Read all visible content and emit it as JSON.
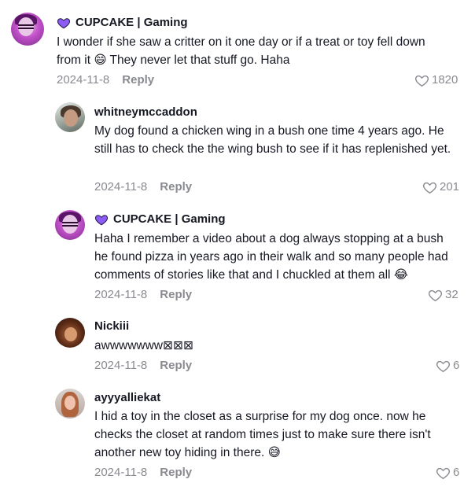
{
  "comments": [
    {
      "username": "CUPCAKE | Gaming",
      "text": "I wonder if she saw a critter on it one day or if a treat or toy fell down from it 😄 They never let that stuff go. Haha",
      "date": "2024-11-8",
      "reply_label": "Reply",
      "likes": "1820",
      "badge": "purple-heart-icon"
    },
    {
      "username": "whitneymccaddon",
      "text": "My dog found a chicken wing in a bush one time 4 years ago. He still has to check the the wing bush to see if it has replenished yet.",
      "date": "2024-11-8",
      "reply_label": "Reply",
      "likes": "201"
    },
    {
      "username": "CUPCAKE | Gaming",
      "text": "Haha I remember a video about a dog always stopping at a bush he found pizza in years ago in their walk and so many people had comments of stories like that and I chuckled at them all 😂",
      "date": "2024-11-8",
      "reply_label": "Reply",
      "likes": "32",
      "badge": "purple-heart-icon"
    },
    {
      "username": "Nickiii",
      "text": "awwwwwww⊠⊠⊠",
      "date": "2024-11-8",
      "reply_label": "Reply",
      "likes": "6"
    },
    {
      "username": "ayyyalliekat",
      "text": "I hid a toy in the closet as a surprise for my dog once. now he checks the closet at random times just to make sure there isn't another new toy hiding in there. 😅",
      "date": "2024-11-8",
      "reply_label": "Reply",
      "likes": "6"
    }
  ],
  "colors": {
    "text": "#161823",
    "muted": "#8a8b91",
    "badge": "#8b5cf6"
  }
}
